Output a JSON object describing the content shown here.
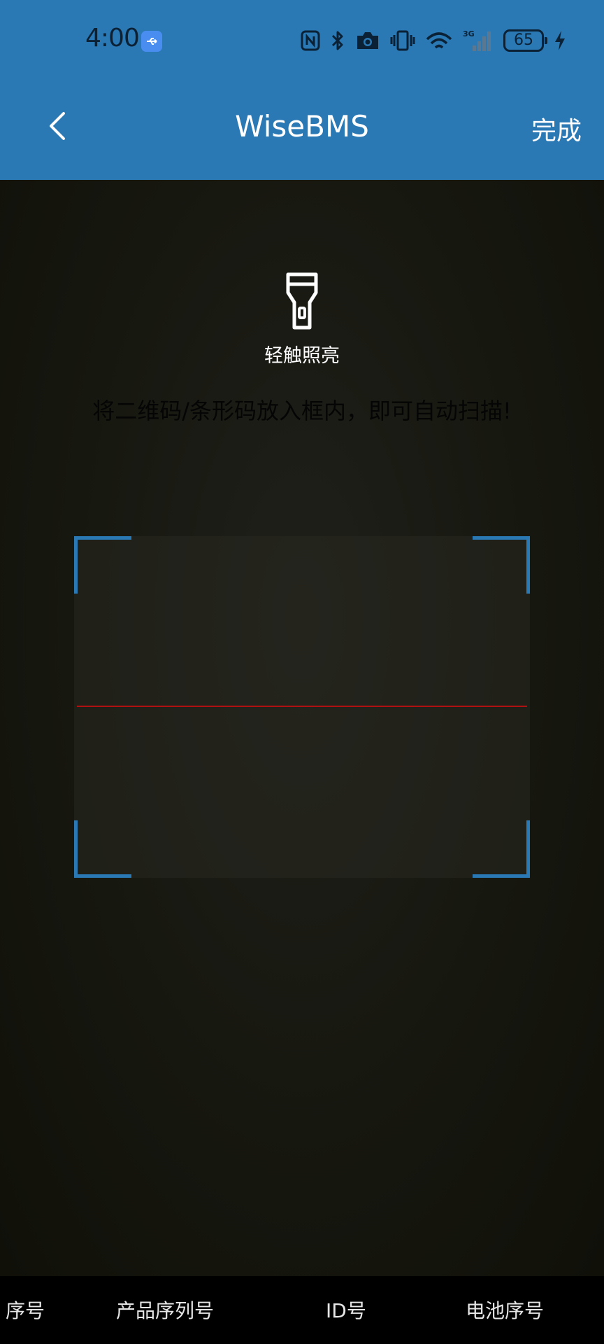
{
  "status_bar": {
    "time": "4:00",
    "battery": "65",
    "icons": [
      "usb-icon",
      "nfc-icon",
      "bluetooth-icon",
      "camera-icon",
      "vibrate-icon",
      "wifi-icon",
      "signal-3g-icon",
      "battery-icon",
      "charging-icon"
    ]
  },
  "header": {
    "title": "WiseBMS",
    "done_label": "完成",
    "color": "#2a78b4"
  },
  "scanner": {
    "torch_label": "轻触照亮",
    "hint": "将二维码/条形码放入框内，即可自动扫描!",
    "frame_color": "#2a78b4",
    "scan_line_color": "#b01010"
  },
  "tabs": [
    {
      "label": "序号"
    },
    {
      "label": "产品序列号"
    },
    {
      "label": "ID号"
    },
    {
      "label": "电池序号"
    }
  ]
}
